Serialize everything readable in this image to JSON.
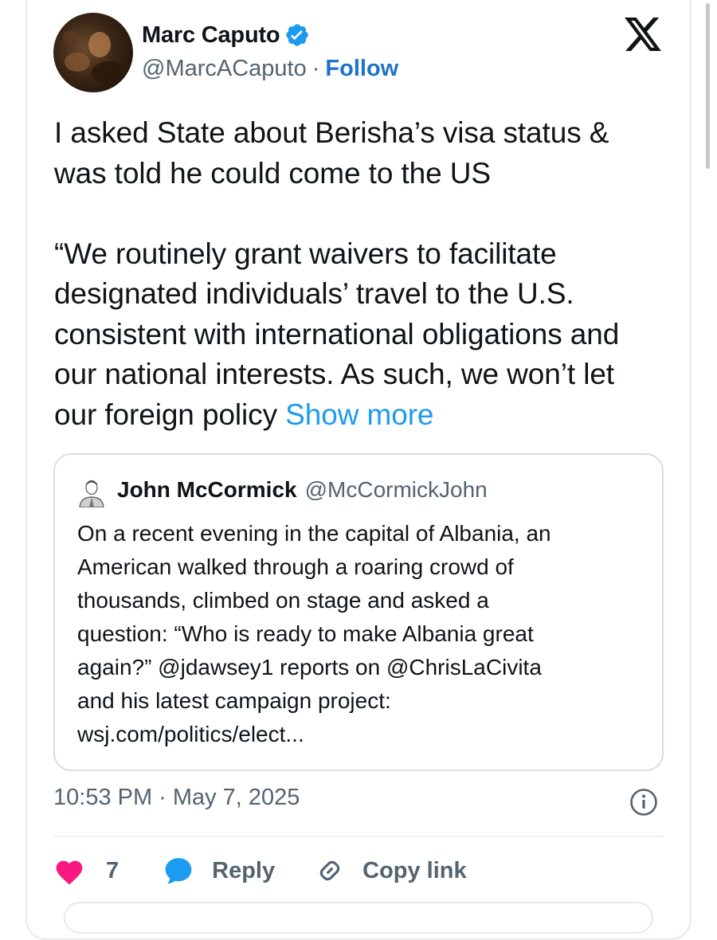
{
  "tweet": {
    "author": {
      "display_name": "Marc Caputo",
      "handle": "@MarcACaputo",
      "separator": "·",
      "follow_label": "Follow",
      "verified_icon": "verified-badge-icon"
    },
    "brand_icon": "x-logo-icon",
    "text_paragraphs": [
      "I asked State about Berisha’s visa status & was told he could come to the US",
      "“We routinely grant waivers to facilitate designated individuals’ travel to the U.S. consistent with international obligations and our national interests. As such, we won’t let our foreign policy"
    ],
    "show_more_label": "Show more",
    "quoted": {
      "display_name": "John McCormick",
      "handle": "@McCormickJohn",
      "lines": [
        "On a recent evening in the capital of Albania, an",
        "American walked through a roaring crowd of",
        "thousands, climbed on stage and asked a",
        "question: “Who is ready to make Albania great",
        "again?” @jdawsey1 reports on @ChrisLaCivita",
        "and his latest campaign project:",
        "wsj.com/politics/elect..."
      ]
    },
    "time": "10:53 PM",
    "date_separator": "·",
    "date": "May 7, 2025",
    "actions": {
      "like_count": "7",
      "reply_label": "Reply",
      "copy_link_label": "Copy link"
    }
  },
  "colors": {
    "accent": "#1d9bf0",
    "follow": "#1d73c9",
    "like": "#f91880",
    "muted": "#536471",
    "text": "#0f1419"
  }
}
